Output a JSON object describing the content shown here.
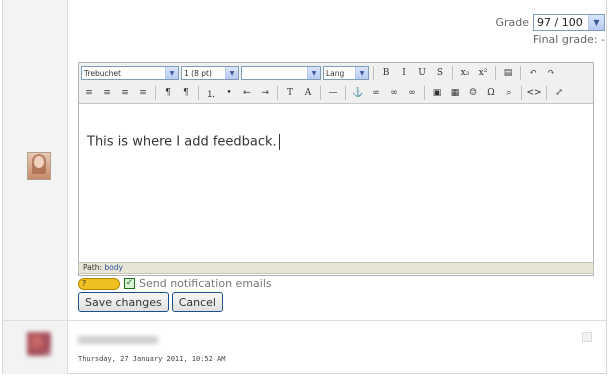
{
  "grade": {
    "label": "Grade",
    "value": "97 / 100",
    "final_label": "Final grade: -"
  },
  "toolbar": {
    "font_family": "Trebuchet",
    "font_size": "1 (8 pt)",
    "heading": "",
    "lang": "Lang",
    "buttons_row1": [
      {
        "name": "bold-button",
        "glyph": "B"
      },
      {
        "name": "italic-button",
        "glyph": "I"
      },
      {
        "name": "underline-button",
        "glyph": "U"
      },
      {
        "name": "strikethrough-button",
        "glyph": "S"
      },
      {
        "name": "subscript-button",
        "glyph": "x₂"
      },
      {
        "name": "superscript-button",
        "glyph": "x²"
      },
      {
        "name": "clean-word-button",
        "glyph": "▤"
      },
      {
        "name": "undo-button",
        "glyph": "↶"
      },
      {
        "name": "redo-button",
        "glyph": "↷"
      }
    ],
    "buttons_row2": [
      {
        "name": "align-left-button",
        "glyph": "≡"
      },
      {
        "name": "align-center-button",
        "glyph": "≡"
      },
      {
        "name": "align-right-button",
        "glyph": "≡"
      },
      {
        "name": "justify-button",
        "glyph": "≡"
      },
      {
        "name": "ltr-button",
        "glyph": "¶"
      },
      {
        "name": "rtl-button",
        "glyph": "¶"
      },
      {
        "name": "ordered-list-button",
        "glyph": "⒈"
      },
      {
        "name": "unordered-list-button",
        "glyph": "•"
      },
      {
        "name": "outdent-button",
        "glyph": "⇤"
      },
      {
        "name": "indent-button",
        "glyph": "⇥"
      },
      {
        "name": "text-color-button",
        "glyph": "T"
      },
      {
        "name": "bg-color-button",
        "glyph": "A"
      },
      {
        "name": "horizontal-rule-button",
        "glyph": "—"
      },
      {
        "name": "anchor-button",
        "glyph": "⚓"
      },
      {
        "name": "link-button",
        "glyph": "∞"
      },
      {
        "name": "unlink-button",
        "glyph": "∞"
      },
      {
        "name": "nolink-button",
        "glyph": "∞"
      },
      {
        "name": "image-button",
        "glyph": "▣"
      },
      {
        "name": "table-button",
        "glyph": "▦"
      },
      {
        "name": "smiley-button",
        "glyph": "☺"
      },
      {
        "name": "special-char-button",
        "glyph": "Ω"
      },
      {
        "name": "search-replace-button",
        "glyph": "⌕"
      },
      {
        "name": "html-source-button",
        "glyph": "<>"
      },
      {
        "name": "fullscreen-button",
        "glyph": "⤢"
      }
    ]
  },
  "editor": {
    "content": "This is where I add feedback."
  },
  "pathbar": {
    "label": "Path:",
    "element": "body"
  },
  "notify": {
    "help": "?",
    "label": "Send notification emails",
    "checked": true
  },
  "actions": {
    "save": "Save changes",
    "cancel": "Cancel"
  },
  "post": {
    "date": "Thursday, 27 January 2011, 10:52 AM"
  }
}
